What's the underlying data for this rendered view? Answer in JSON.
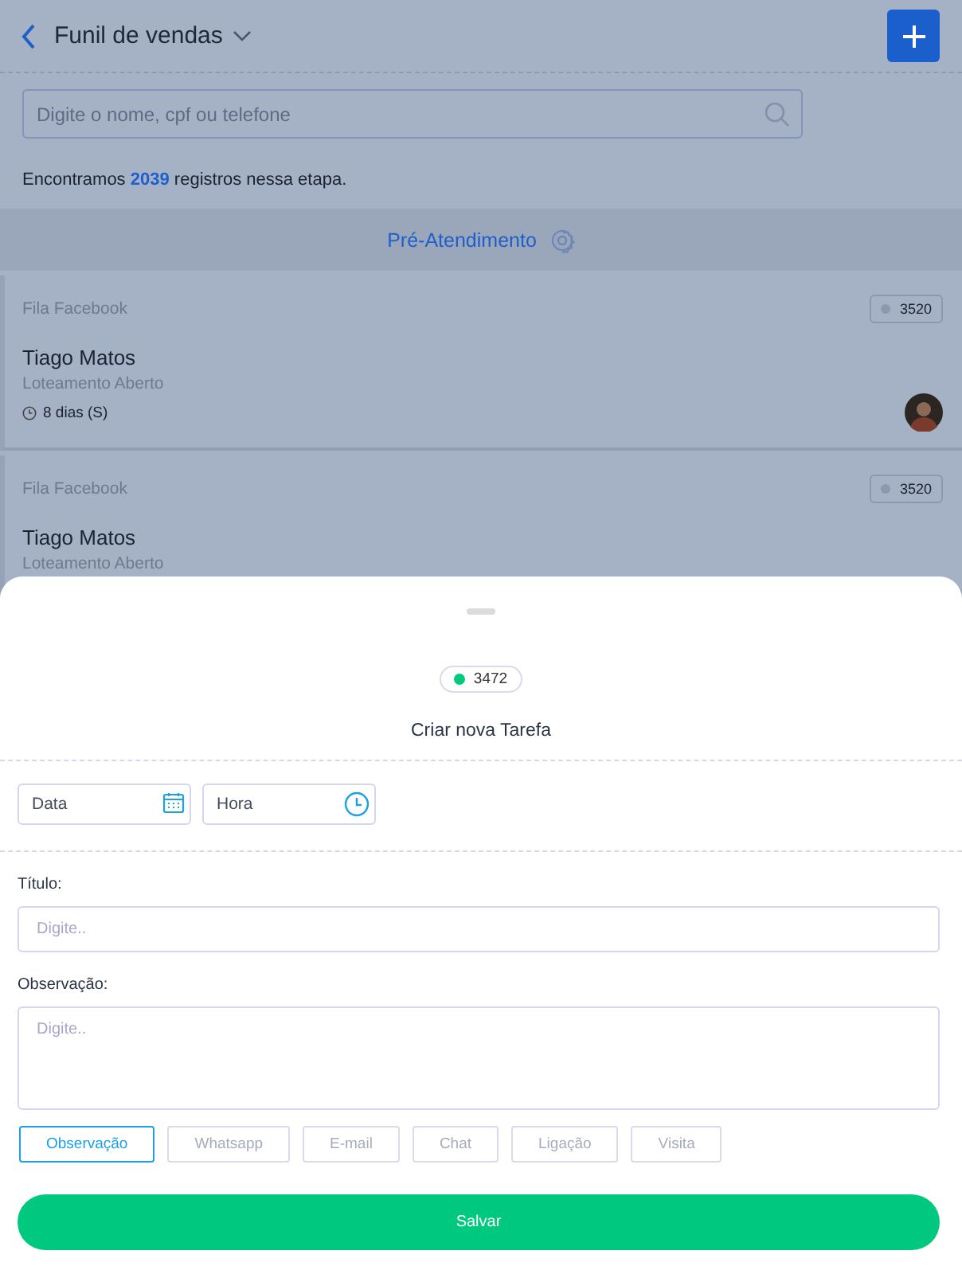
{
  "header": {
    "title": "Funil de vendas"
  },
  "search": {
    "placeholder": "Digite o nome, cpf ou telefone"
  },
  "summary": "Encontramos **2039** registros nessa etapa.",
  "stage": {
    "title": "Pré-Atendimento"
  },
  "cards": [
    {
      "queue": "Fila Facebook",
      "badge": "3520",
      "name": "Tiago Matos",
      "project": "Loteamento Aberto",
      "age": "8 dias (S)"
    },
    {
      "queue": "Fila Facebook",
      "badge": "3520",
      "name": "Tiago Matos",
      "project": "Loteamento Aberto"
    }
  ],
  "sheet": {
    "badge": "3472",
    "title": "Criar nova Tarefa",
    "date": {
      "placeholder": "Data"
    },
    "time": {
      "placeholder": "Hora"
    },
    "title_label": "Título:",
    "title_field": {
      "placeholder": "Digite.."
    },
    "note_label": "Observação:",
    "note_field": {
      "placeholder": "Digite.."
    },
    "types": [
      {
        "label": "Observação",
        "selected": true
      },
      {
        "label": "Whatsapp",
        "selected": false
      },
      {
        "label": "E-mail",
        "selected": false
      },
      {
        "label": "Chat",
        "selected": false
      },
      {
        "label": "Ligação",
        "selected": false
      },
      {
        "label": "Visita",
        "selected": false
      }
    ],
    "save": "Salvar"
  }
}
